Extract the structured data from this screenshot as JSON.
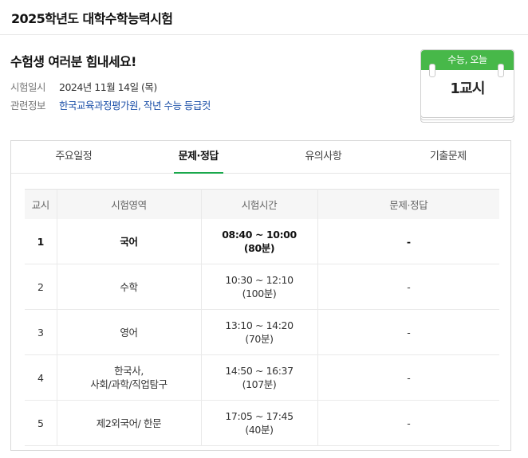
{
  "header": {
    "title": "2025학년도 대학수학능력시험"
  },
  "intro": {
    "headline": "수험생 여러분 힘내세요!",
    "date_label": "시험일시",
    "date_value": "2024년 11월 14일 (목)",
    "related_label": "관련정보",
    "related_link1": "한국교육과정평가원",
    "related_sep": ", ",
    "related_link2": "작년 수능 등급컷"
  },
  "calendar": {
    "top": "수능, 오늘",
    "period": "1교시",
    "accent": "#47b849"
  },
  "tabs": [
    {
      "label": "주요일정",
      "active": false
    },
    {
      "label": "문제·정답",
      "active": true
    },
    {
      "label": "유의사항",
      "active": false
    },
    {
      "label": "기출문제",
      "active": false
    }
  ],
  "table": {
    "headers": [
      "교시",
      "시험영역",
      "시험시간",
      "문제·정답"
    ],
    "rows": [
      {
        "period": "1",
        "subject": "국어",
        "time": "08:40 ~ 10:00",
        "duration": "(80분)",
        "answers": "-",
        "current": true
      },
      {
        "period": "2",
        "subject": "수학",
        "time": "10:30 ~ 12:10",
        "duration": "(100분)",
        "answers": "-"
      },
      {
        "period": "3",
        "subject": "영어",
        "time": "13:10 ~ 14:20",
        "duration": "(70분)",
        "answers": "-"
      },
      {
        "period": "4",
        "subject": "한국사,",
        "subject2": "사회/과학/직업탐구",
        "time": "14:50 ~ 16:37",
        "duration": "(107분)",
        "answers": "-"
      },
      {
        "period": "5",
        "subject": "제2외국어/ 한문",
        "time": "17:05 ~ 17:45",
        "duration": "(40분)",
        "answers": "-"
      }
    ]
  }
}
